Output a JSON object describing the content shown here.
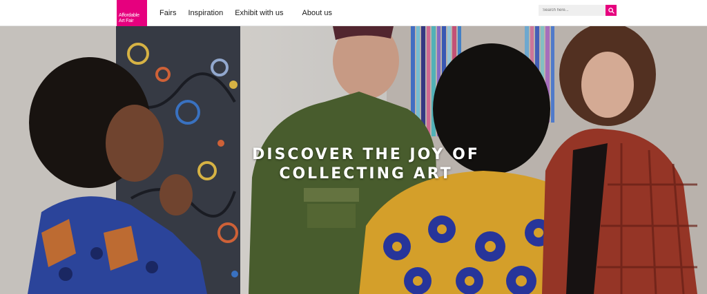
{
  "header": {
    "logo": {
      "line1": "Affordable",
      "line2": "Art Fair",
      "color": "#e6007e"
    },
    "nav": [
      {
        "label": "Fairs"
      },
      {
        "label": "Inspiration"
      },
      {
        "label": "Exhibit with us"
      },
      {
        "label": "About us"
      }
    ],
    "search": {
      "placeholder": "Search here...",
      "icon": "search-icon",
      "button_color": "#e6007e"
    }
  },
  "hero": {
    "title_line1": "DISCOVER THE JOY OF",
    "title_line2": "COLLECTING ART"
  }
}
